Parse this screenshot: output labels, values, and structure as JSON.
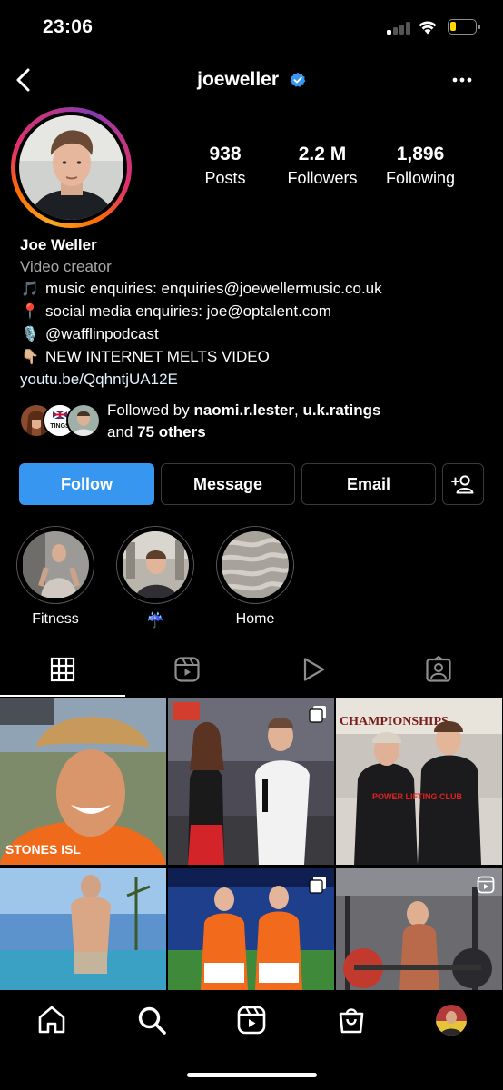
{
  "status_bar": {
    "time": "23:06",
    "battery_level": 0.25,
    "battery_color": "#ffd60a",
    "signal_bars_active": 1
  },
  "header": {
    "username": "joeweller",
    "verified": true,
    "back_icon": "chevron-left-icon",
    "more_icon": "more-horizontal-icon"
  },
  "stats": {
    "posts": {
      "value": "938",
      "label": "Posts"
    },
    "followers": {
      "value": "2.2 M",
      "label": "Followers"
    },
    "following": {
      "value": "1,896",
      "label": "Following"
    }
  },
  "bio": {
    "name": "Joe Weller",
    "category": "Video creator",
    "lines": [
      {
        "emoji": "🎵",
        "text": "music enquiries: enquiries@joewellermusic.co.uk"
      },
      {
        "emoji": "📍",
        "text": "social media enquiries: joe@optalent.com"
      },
      {
        "emoji": "🎙️",
        "text": "@wafflinpodcast"
      },
      {
        "emoji": "👇🏼",
        "text": "NEW INTERNET MELTS VIDEO"
      }
    ],
    "link": "youtu.be/QqhntjUA12E"
  },
  "followed_by": {
    "prefix": "Followed by ",
    "user1": "naomi.r.lester",
    "separator": ", ",
    "user2": "u.k.ratings",
    "and_text": "and ",
    "others": "75 others",
    "mini_avatar_text": "TINGS"
  },
  "actions": {
    "follow": "Follow",
    "message": "Message",
    "email": "Email",
    "add_user_icon": "add-user-icon",
    "follow_color": "#3797f0"
  },
  "highlights": [
    {
      "label": "Fitness"
    },
    {
      "label": "☔"
    },
    {
      "label": "Home"
    }
  ],
  "tabs": [
    {
      "icon": "grid-icon",
      "active": true
    },
    {
      "icon": "reels-icon",
      "active": false
    },
    {
      "icon": "play-icon",
      "active": false
    },
    {
      "icon": "tagged-icon",
      "active": false
    }
  ],
  "grid_posts": [
    {
      "badge": null
    },
    {
      "badge": "multi-post-icon"
    },
    {
      "badge": null
    },
    {
      "badge": null
    },
    {
      "badge": "multi-post-icon"
    },
    {
      "badge": "reel-icon"
    }
  ],
  "posters": {
    "championship_banner": "CHAMPIONSHIPS",
    "club_shirt": "POWER LIFTING CLUB"
  },
  "bottom_nav": [
    {
      "icon": "home-icon"
    },
    {
      "icon": "search-icon"
    },
    {
      "icon": "reels-icon"
    },
    {
      "icon": "shop-icon"
    },
    {
      "icon": "profile-avatar"
    }
  ]
}
